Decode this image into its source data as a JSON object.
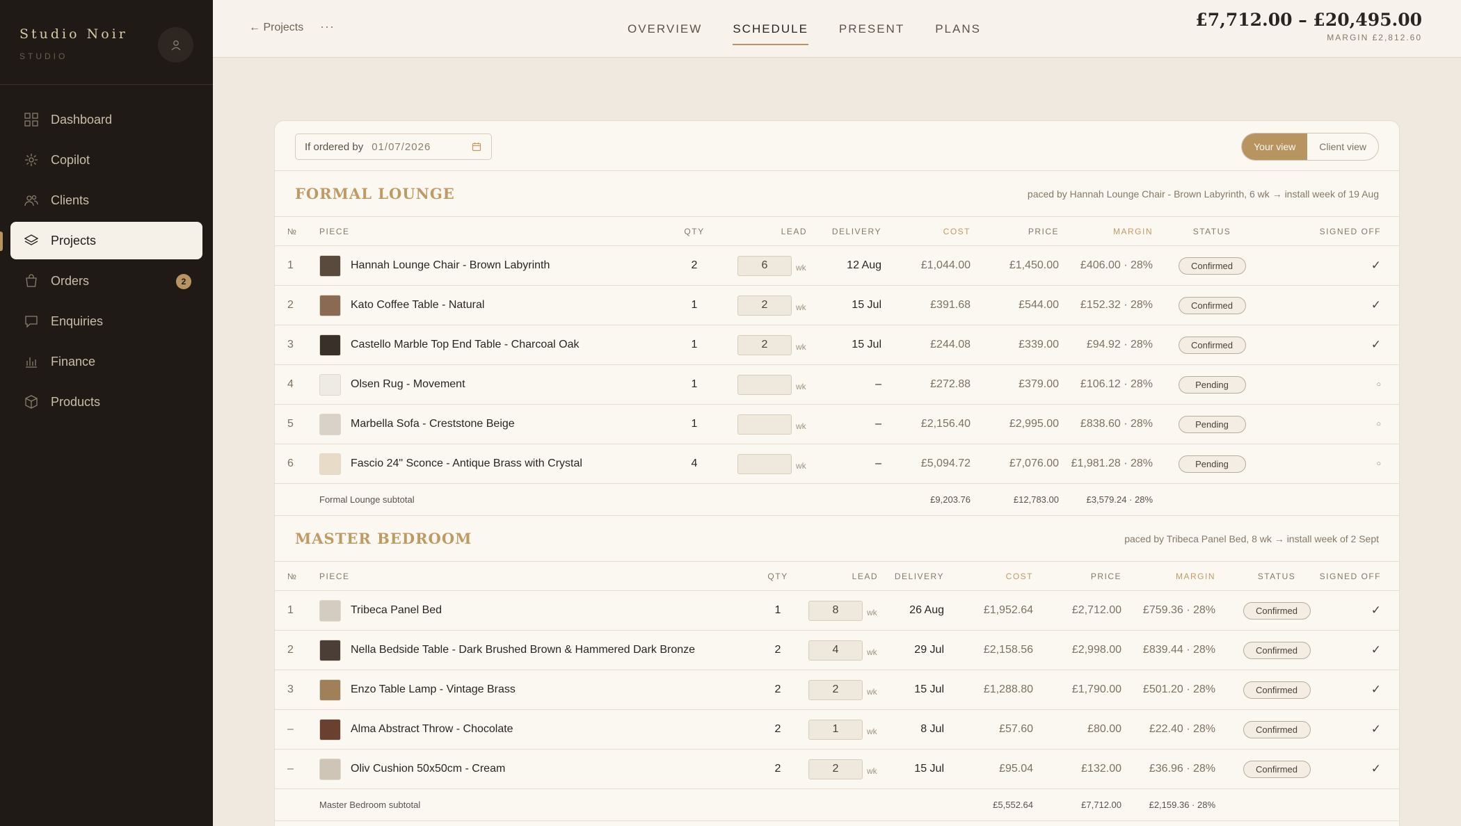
{
  "brand": {
    "name": "Studio Noir",
    "sub": "STUDIO"
  },
  "nav": [
    {
      "label": "Dashboard",
      "icon": "grid-icon"
    },
    {
      "label": "Copilot",
      "icon": "sparkle-icon"
    },
    {
      "label": "Clients",
      "icon": "users-icon"
    },
    {
      "label": "Projects",
      "icon": "layers-icon",
      "active": true
    },
    {
      "label": "Orders",
      "icon": "bag-icon",
      "badge": "2"
    },
    {
      "label": "Enquiries",
      "icon": "chat-icon"
    },
    {
      "label": "Finance",
      "icon": "bar-chart-icon"
    },
    {
      "label": "Products",
      "icon": "box-icon"
    }
  ],
  "topbar": {
    "back": "← Projects",
    "more": "···",
    "tabs": [
      "OVERVIEW",
      "SCHEDULE",
      "PRESENT",
      "PLANS"
    ],
    "active_tab": "SCHEDULE",
    "range": "£7,712.00 – £20,495.00",
    "margin": "MARGIN £2,812.60"
  },
  "toolbar": {
    "date_label": "If ordered by",
    "date_value": "01/07/2026",
    "your_view": "Your view",
    "client_view": "Client view"
  },
  "colors": {
    "accent": "#b89560",
    "sidebar": "#1f1a16",
    "background": "#efe9df"
  },
  "sections": [
    {
      "title": "FORMAL LOUNGE",
      "note": "paced by Hannah Lounge Chair - Brown Labyrinth, 6 wk → install week of 19 Aug",
      "headers": {
        "no": "№",
        "piece": "PIECE",
        "qty": "QTY",
        "lead": "LEAD",
        "delivery": "DELIVERY",
        "cost": "COST",
        "price": "PRICE",
        "margin": "MARGIN",
        "status": "STATUS",
        "signed": "SIGNED OFF"
      },
      "rows": [
        {
          "no": "1",
          "piece": "Hannah Lounge Chair - Brown Labyrinth",
          "qty": "2",
          "lead": "6",
          "wk": "wk",
          "delivery": "12 Aug",
          "cost": "£1,044.00",
          "price": "£1,450.00",
          "margin": "£406.00 · 28%",
          "status": "Confirmed",
          "signed": "✓",
          "thumb": "#5a4a3e"
        },
        {
          "no": "2",
          "piece": "Kato Coffee Table - Natural",
          "qty": "1",
          "lead": "2",
          "wk": "wk",
          "delivery": "15 Jul",
          "cost": "£391.68",
          "price": "£544.00",
          "margin": "£152.32 · 28%",
          "status": "Confirmed",
          "signed": "✓",
          "thumb": "#8a6a52"
        },
        {
          "no": "3",
          "piece": "Castello Marble Top End Table - Charcoal Oak",
          "qty": "1",
          "lead": "2",
          "wk": "wk",
          "delivery": "15 Jul",
          "cost": "£244.08",
          "price": "£339.00",
          "margin": "£94.92 · 28%",
          "status": "Confirmed",
          "signed": "✓",
          "thumb": "#3a302a"
        },
        {
          "no": "4",
          "piece": "Olsen Rug - Movement",
          "qty": "1",
          "lead": "",
          "wk": "wk",
          "delivery": "–",
          "cost": "£272.88",
          "price": "£379.00",
          "margin": "£106.12 · 28%",
          "status": "Pending",
          "signed": "○",
          "thumb": "#eeeae4"
        },
        {
          "no": "5",
          "piece": "Marbella Sofa - Creststone Beige",
          "qty": "1",
          "lead": "",
          "wk": "wk",
          "delivery": "–",
          "cost": "£2,156.40",
          "price": "£2,995.00",
          "margin": "£838.60 · 28%",
          "status": "Pending",
          "signed": "○",
          "thumb": "#d8d2c8"
        },
        {
          "no": "6",
          "piece": "Fascio 24\" Sconce - Antique Brass with Crystal",
          "qty": "4",
          "lead": "",
          "wk": "wk",
          "delivery": "–",
          "cost": "£5,094.72",
          "price": "£7,076.00",
          "margin": "£1,981.28 · 28%",
          "status": "Pending",
          "signed": "○",
          "thumb": "#e8dcc8"
        }
      ],
      "subtotal": {
        "label": "Formal Lounge subtotal",
        "cost": "£9,203.76",
        "price": "£12,783.00",
        "margin": "£3,579.24 · 28%"
      }
    },
    {
      "title": "MASTER BEDROOM",
      "note": "paced by Tribeca Panel Bed, 8 wk → install week of 2 Sept",
      "headers": {
        "no": "№",
        "piece": "PIECE",
        "qty": "QTY",
        "lead": "LEAD",
        "delivery": "DELIVERY",
        "cost": "COST",
        "price": "PRICE",
        "margin": "MARGIN",
        "status": "STATUS",
        "signed": "SIGNED OFF"
      },
      "rows": [
        {
          "no": "1",
          "piece": "Tribeca Panel Bed",
          "qty": "1",
          "lead": "8",
          "wk": "wk",
          "delivery": "26 Aug",
          "cost": "£1,952.64",
          "price": "£2,712.00",
          "margin": "£759.36 · 28%",
          "status": "Confirmed",
          "signed": "✓",
          "thumb": "#d4ccc0"
        },
        {
          "no": "2",
          "piece": "Nella Bedside Table - Dark Brushed Brown & Hammered Dark Bronze",
          "qty": "2",
          "lead": "4",
          "wk": "wk",
          "delivery": "29 Jul",
          "cost": "£2,158.56",
          "price": "£2,998.00",
          "margin": "£839.44 · 28%",
          "status": "Confirmed",
          "signed": "✓",
          "thumb": "#4a3e36"
        },
        {
          "no": "3",
          "piece": "Enzo Table Lamp - Vintage Brass",
          "qty": "2",
          "lead": "2",
          "wk": "wk",
          "delivery": "15 Jul",
          "cost": "£1,288.80",
          "price": "£1,790.00",
          "margin": "£501.20 · 28%",
          "status": "Confirmed",
          "signed": "✓",
          "thumb": "#a08058"
        },
        {
          "no": "–",
          "piece": "Alma Abstract Throw - Chocolate",
          "qty": "2",
          "lead": "1",
          "wk": "wk",
          "delivery": "8 Jul",
          "cost": "£57.60",
          "price": "£80.00",
          "margin": "£22.40 · 28%",
          "status": "Confirmed",
          "signed": "✓",
          "thumb": "#6a4030"
        },
        {
          "no": "–",
          "piece": "Oliv Cushion 50x50cm - Cream",
          "qty": "2",
          "lead": "2",
          "wk": "wk",
          "delivery": "15 Jul",
          "cost": "£95.04",
          "price": "£132.00",
          "margin": "£36.96 · 28%",
          "status": "Confirmed",
          "signed": "✓",
          "thumb": "#cfc5b6"
        }
      ],
      "subtotal": {
        "label": "Master Bedroom subtotal",
        "cost": "£5,552.64",
        "price": "£7,712.00",
        "margin": "£2,159.36 · 28%"
      }
    }
  ]
}
